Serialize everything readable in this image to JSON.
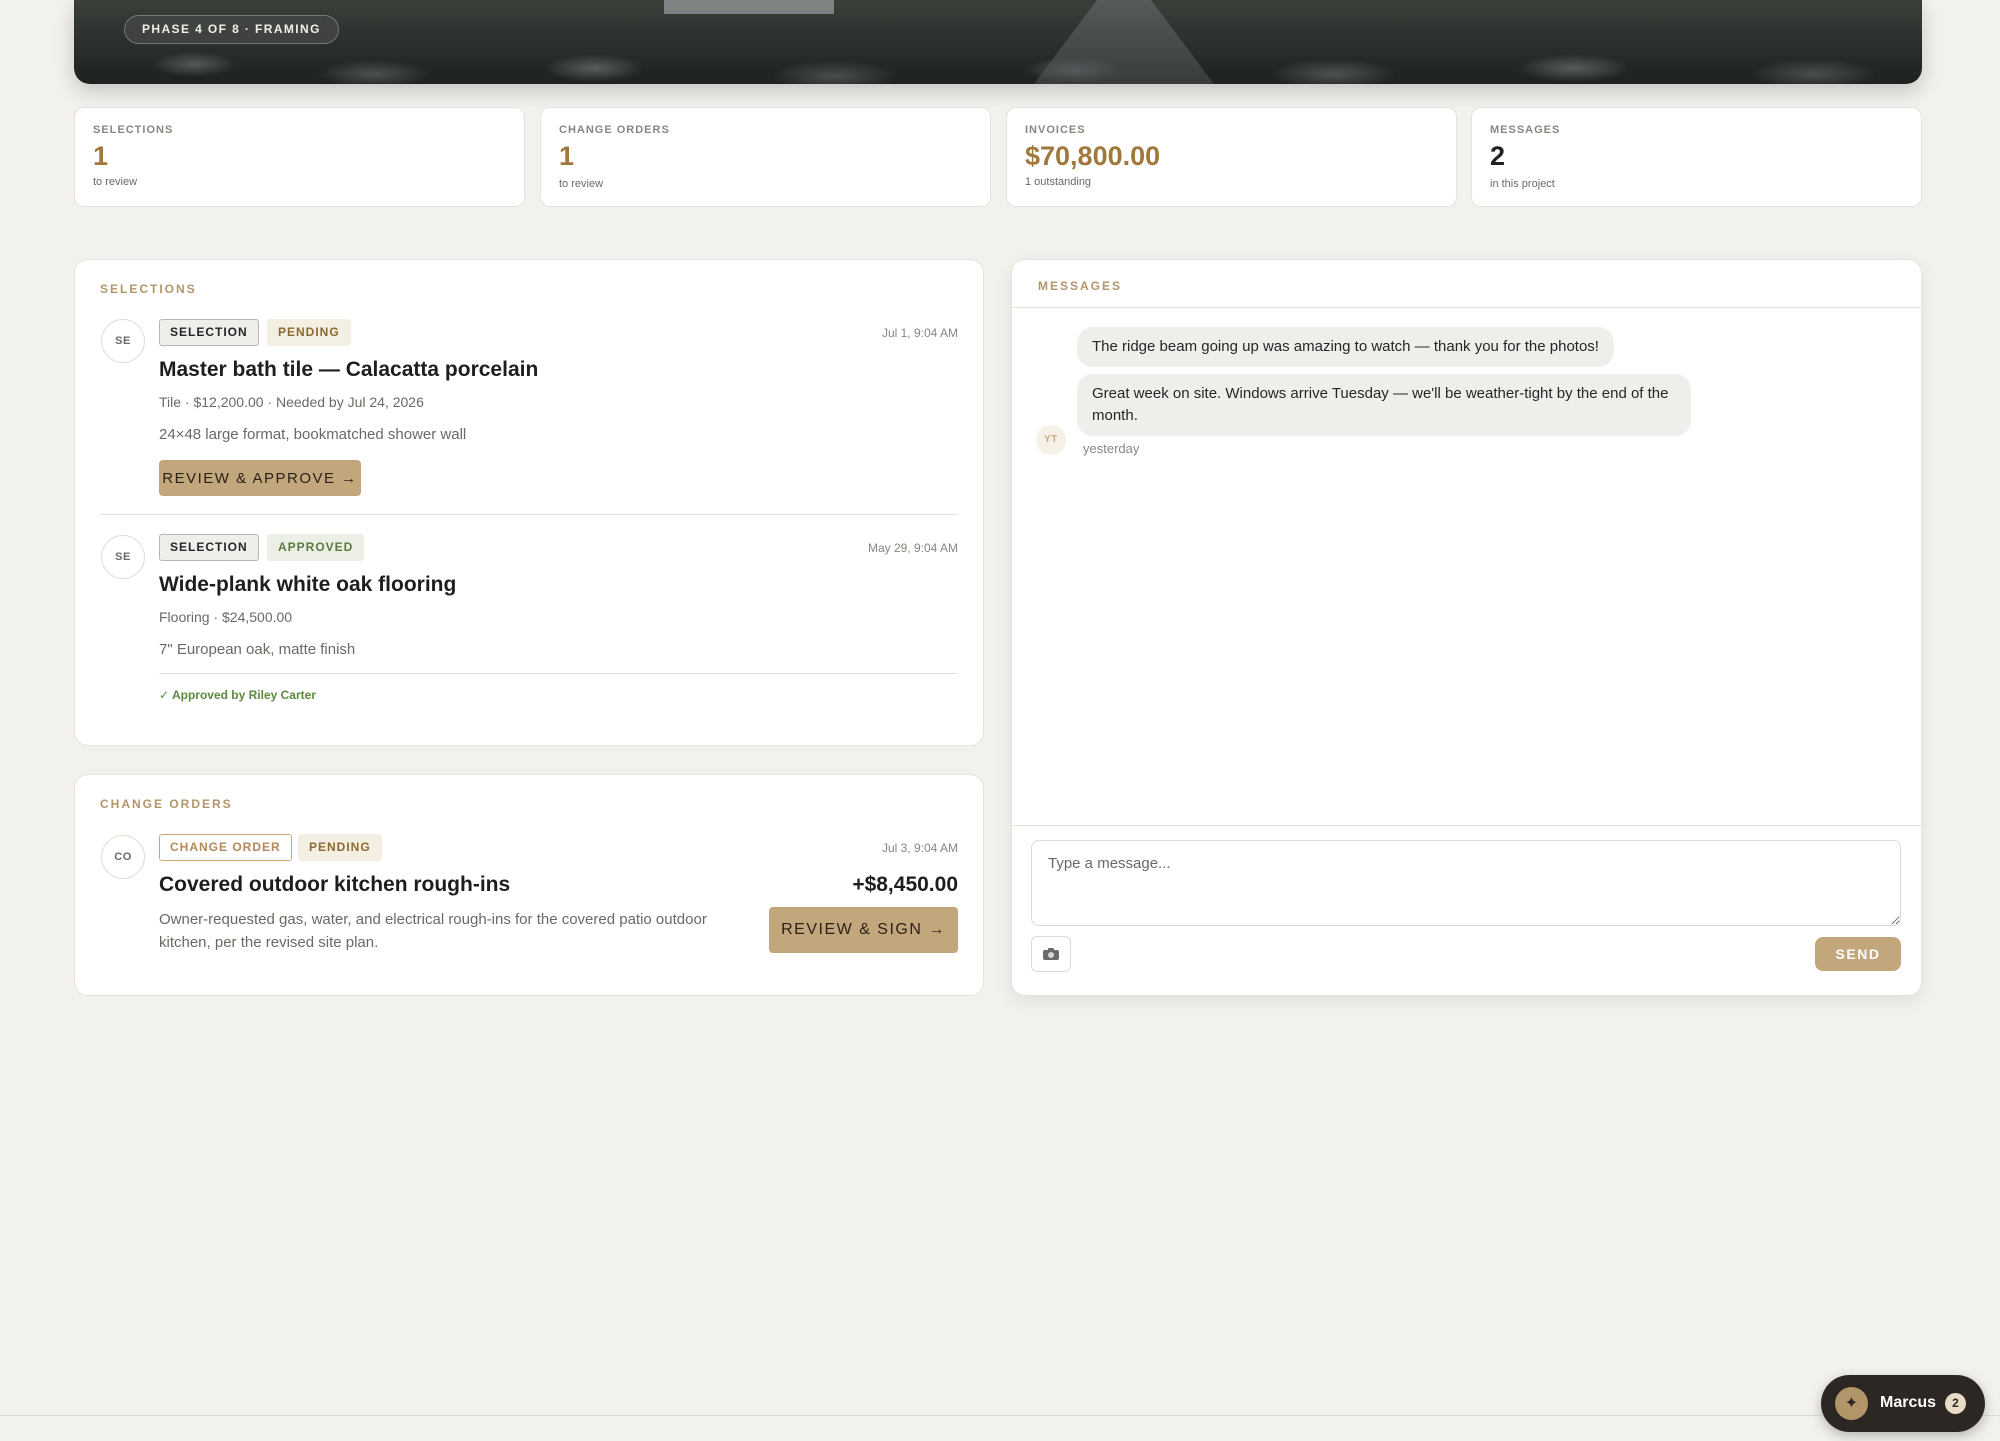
{
  "hero": {
    "phase_label": "PHASE 4 OF 8 · FRAMING"
  },
  "stats": [
    {
      "label": "SELECTIONS",
      "value": "1",
      "sub": "to review"
    },
    {
      "label": "CHANGE ORDERS",
      "value": "1",
      "sub": "to review"
    },
    {
      "label": "INVOICES",
      "value": "$70,800.00",
      "sub": "1 outstanding"
    },
    {
      "label": "MESSAGES",
      "value": "2",
      "sub": "in this project"
    }
  ],
  "selections": {
    "title": "SELECTIONS",
    "items": [
      {
        "avatar": "SE",
        "type_tag": "SELECTION",
        "status_tag": "PENDING",
        "timestamp": "Jul 1, 9:04 AM",
        "title": "Master bath tile — Calacatta porcelain",
        "meta": "Tile · $12,200.00 · Needed by Jul 24, 2026",
        "description": "24×48 large format, bookmatched shower wall",
        "action": "REVIEW & APPROVE →"
      },
      {
        "avatar": "SE",
        "type_tag": "SELECTION",
        "status_tag": "APPROVED",
        "timestamp": "May 29, 9:04 AM",
        "title": "Wide-plank white oak flooring",
        "meta": "Flooring · $24,500.00",
        "description": "7\" European oak, matte finish",
        "approved_by": "✓ Approved by Riley Carter"
      }
    ]
  },
  "change_orders": {
    "title": "CHANGE ORDERS",
    "items": [
      {
        "avatar": "CO",
        "type_tag": "CHANGE ORDER",
        "status_tag": "PENDING",
        "timestamp": "Jul 3, 9:04 AM",
        "title": "Covered outdoor kitchen rough-ins",
        "amount": "+$8,450.00",
        "description": "Owner-requested gas, water, and electrical rough-ins for the covered patio outdoor kitchen, per the revised site plan.",
        "action": "REVIEW & SIGN →"
      }
    ]
  },
  "messages": {
    "title": "MESSAGES",
    "thread": [
      {
        "text": "The ridge beam going up was amazing to watch — thank you for the photos!"
      },
      {
        "text": "Great week on site. Windows arrive Tuesday — we'll be weather-tight by the end of the month."
      }
    ],
    "sender_avatar": "YT",
    "time": "yesterday",
    "input_placeholder": "Type a message...",
    "attach_icon": "camera-icon",
    "send_label": "SEND"
  },
  "assistant": {
    "name": "Marcus",
    "badge": "2",
    "icon": "sparkle-icon"
  },
  "colors": {
    "accent": "#c2a67c",
    "accent_text": "#a0783b",
    "background": "#f2f1ed",
    "approved_green": "#5b8a3f"
  }
}
